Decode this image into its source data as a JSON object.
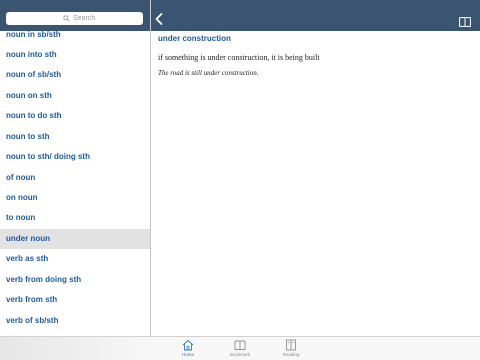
{
  "search": {
    "placeholder": "Search"
  },
  "sidebar": {
    "items": [
      {
        "label": "noun in sb/sth"
      },
      {
        "label": "noun into sth"
      },
      {
        "label": "noun of sb/sth"
      },
      {
        "label": "noun on sth"
      },
      {
        "label": "noun to do sth"
      },
      {
        "label": "noun to sth"
      },
      {
        "label": "noun to sth/ doing sth"
      },
      {
        "label": "of noun"
      },
      {
        "label": "on noun"
      },
      {
        "label": "to noun"
      },
      {
        "label": "under noun",
        "selected": true
      },
      {
        "label": "verb as sth"
      },
      {
        "label": "verb from doing sth"
      },
      {
        "label": "verb from sth"
      },
      {
        "label": "verb of sb/sth"
      }
    ]
  },
  "entry": {
    "headword": "under construction",
    "definition": "if something is under construction, it is being built",
    "example": "The road is still under construction."
  },
  "tabs": [
    {
      "label": "Home",
      "icon": "home-icon",
      "active": true
    },
    {
      "label": "Bookmark",
      "icon": "bookmark-icon",
      "active": false
    },
    {
      "label": "Reading",
      "icon": "reading-icon",
      "active": false
    }
  ],
  "colors": {
    "header": "#3a5472",
    "link": "#1f5a9c",
    "selected_row": "#e2e2e2",
    "active_tab": "#2f79c9"
  }
}
